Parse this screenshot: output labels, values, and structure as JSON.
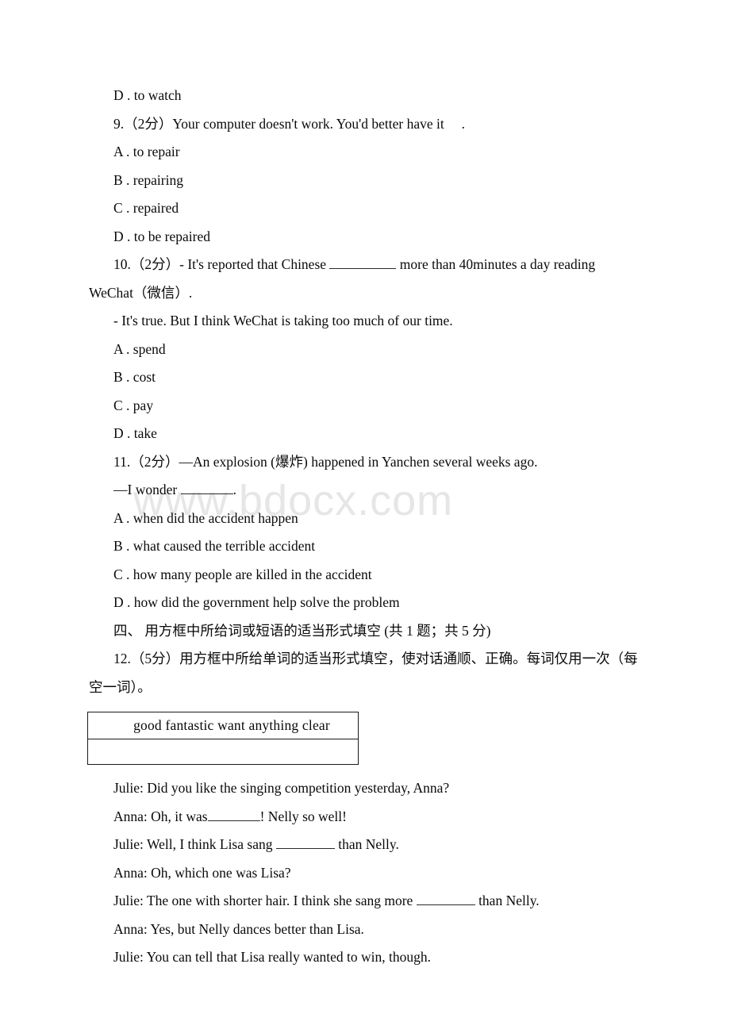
{
  "watermark": "www.bdocx.com",
  "document": {
    "type": "english-exam-paper",
    "items": [
      {
        "kind": "option",
        "name": "option-d-to-watch",
        "text": "D . to watch"
      },
      {
        "kind": "question",
        "name": "question-9",
        "number": "9.",
        "points": "（2 分）",
        "text": "9.（2分）Your computer doesn't work. You'd better have it     ."
      },
      {
        "kind": "option",
        "name": "q9-option-a",
        "text": "A . to repair"
      },
      {
        "kind": "option",
        "name": "q9-option-b",
        "text": "B . repairing"
      },
      {
        "kind": "option",
        "name": "q9-option-c",
        "text": "C . repaired"
      },
      {
        "kind": "option",
        "name": "q9-option-d",
        "text": "D . to be repaired"
      },
      {
        "kind": "question",
        "name": "question-10",
        "number": "10.",
        "points": "（2分）",
        "text_before_blank": "10.（2分）- It's reported that Chinese ",
        "text_after_blank": " more than 40minutes a day reading WeChat（微信）."
      },
      {
        "kind": "question-continued",
        "name": "question-10-reply",
        "text": "- It's true. But I think WeChat is taking too much of our time."
      },
      {
        "kind": "option",
        "name": "q10-option-a",
        "text": "A . spend"
      },
      {
        "kind": "option",
        "name": "q10-option-b",
        "text": "B . cost"
      },
      {
        "kind": "option",
        "name": "q10-option-c",
        "text": "C . pay"
      },
      {
        "kind": "option",
        "name": "q10-option-d",
        "text": "D . take"
      },
      {
        "kind": "question",
        "name": "question-11",
        "number": "11.",
        "points": "（2分）",
        "text": "11.（2分）—An explosion (爆炸) happened in Yanchen several weeks ago."
      },
      {
        "kind": "question-continued",
        "name": "question-11-reply",
        "text_before_blank": "—I wonder ",
        "text_after_blank": "."
      },
      {
        "kind": "option",
        "name": "q11-option-a",
        "text": "A . when did the accident happen"
      },
      {
        "kind": "option",
        "name": "q11-option-b",
        "text": "B . what caused the terrible accident"
      },
      {
        "kind": "option",
        "name": "q11-option-c",
        "text": "C . how many people are killed in the accident"
      },
      {
        "kind": "option",
        "name": "q11-option-d",
        "text": "D . how did the government help solve the problem"
      }
    ],
    "section_four": {
      "heading": "四、 用方框中所给词或短语的适当形式填空 (共 1 题；共 5 分)",
      "question_12": {
        "number": "12.",
        "points": "（5分）",
        "instruction": "12.（5分）用方框中所给单词的适当形式填空，使对话通顺、正确。每词仅用一次（每空一词）。",
        "word_box": {
          "words": [
            "good",
            "fantastic",
            "want",
            "anything",
            "clear"
          ],
          "words_line": "good  fantastic  want  anything  clear",
          "second_row": ""
        },
        "dialogue": [
          {
            "name": "dialogue-line-1",
            "speaker": "Julie",
            "text": "Julie: Did you like the singing competition yesterday, Anna?"
          },
          {
            "name": "dialogue-line-2",
            "speaker": "Anna",
            "text_before_blank": "Anna: Oh, it was",
            "text_after_blank": "! Nelly so well!"
          },
          {
            "name": "dialogue-line-3",
            "speaker": "Julie",
            "text_before_blank": "Julie: Well, I think Lisa sang ",
            "text_after_blank": " than Nelly."
          },
          {
            "name": "dialogue-line-4",
            "speaker": "Anna",
            "text": "Anna: Oh, which one was Lisa?"
          },
          {
            "name": "dialogue-line-5",
            "speaker": "Julie",
            "text_before_blank": "Julie: The one with shorter hair. I think she sang more ",
            "text_after_blank": " than Nelly."
          },
          {
            "name": "dialogue-line-6",
            "speaker": "Anna",
            "text": "Anna: Yes, but Nelly dances better than Lisa."
          },
          {
            "name": "dialogue-line-7",
            "speaker": "Julie",
            "text": "Julie: You can tell that Lisa really wanted to win, though."
          }
        ]
      }
    }
  }
}
